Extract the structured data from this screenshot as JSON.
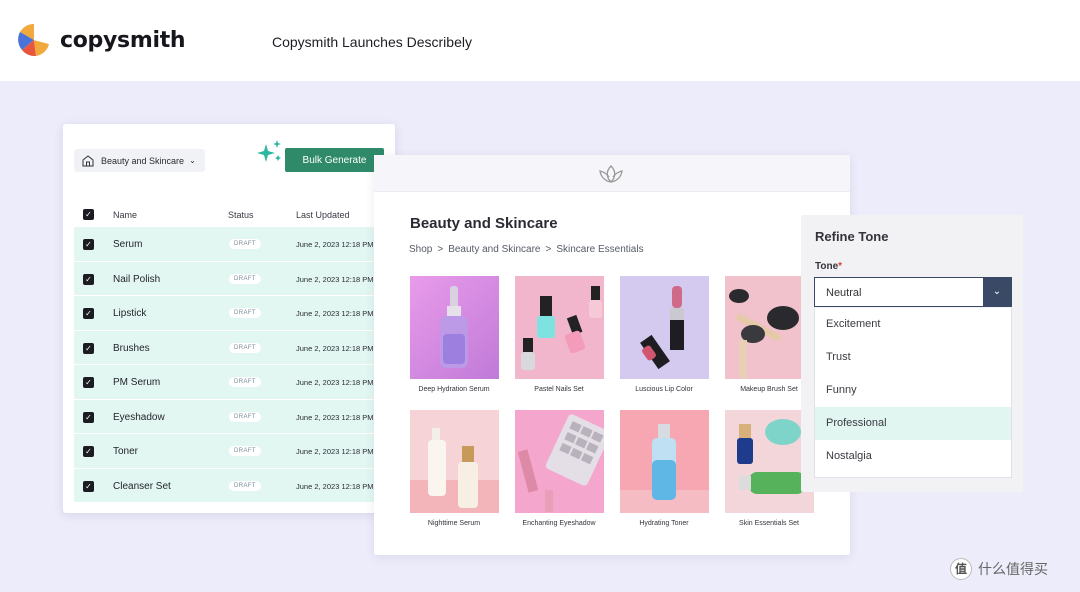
{
  "header": {
    "brand": "copysmith",
    "headline": "Copysmith Launches Describely"
  },
  "list_panel": {
    "category_select": "Beauty and Skincare",
    "bulk_button": "Bulk Generate",
    "columns": [
      "Name",
      "Status",
      "Last Updated"
    ],
    "rows": [
      {
        "name": "Serum",
        "status": "DRAFT",
        "date": "June 2, 2023  12:18 PM"
      },
      {
        "name": "Nail Polish",
        "status": "DRAFT",
        "date": "June 2, 2023  12:18 PM"
      },
      {
        "name": "Lipstick",
        "status": "DRAFT",
        "date": "June 2, 2023  12:18 PM"
      },
      {
        "name": "Brushes",
        "status": "DRAFT",
        "date": "June 2, 2023  12:18 PM"
      },
      {
        "name": "PM Serum",
        "status": "DRAFT",
        "date": "June 2, 2023  12:18 PM"
      },
      {
        "name": "Eyeshadow",
        "status": "DRAFT",
        "date": "June 2, 2023  12:18 PM"
      },
      {
        "name": "Toner",
        "status": "DRAFT",
        "date": "June 2, 2023  12:18 PM"
      },
      {
        "name": "Cleanser Set",
        "status": "DRAFT",
        "date": "June 2, 2023  12:18 PM"
      }
    ]
  },
  "shop": {
    "title": "Beauty and Skincare",
    "breadcrumb": [
      "Shop",
      "Beauty and Skincare",
      "Skincare Essentials"
    ],
    "breadcrumb_sep": ">",
    "products": [
      {
        "name": "Deep Hydration Serum"
      },
      {
        "name": "Pastel Nails Set"
      },
      {
        "name": "Luscious Lip Color"
      },
      {
        "name": "Makeup Brush Set"
      },
      {
        "name": "Nighttime Serum"
      },
      {
        "name": "Enchanting Eyeshadow"
      },
      {
        "name": "Hydrating Toner"
      },
      {
        "name": "Skin Essentials Set"
      }
    ]
  },
  "tone_panel": {
    "title": "Refine Tone",
    "label": "Tone",
    "required_mark": "*",
    "selected": "Neutral",
    "options": [
      "Excitement",
      "Trust",
      "Funny",
      "Professional",
      "Nostalgia"
    ],
    "highlighted": "Professional"
  },
  "watermark": {
    "glyph": "值",
    "text": "什么值得买"
  },
  "colors": {
    "accent": "#2f8a6a",
    "row_bg": "#e2f7f2",
    "page_bg": "#ececfa",
    "select_dark": "#3a4a66"
  }
}
